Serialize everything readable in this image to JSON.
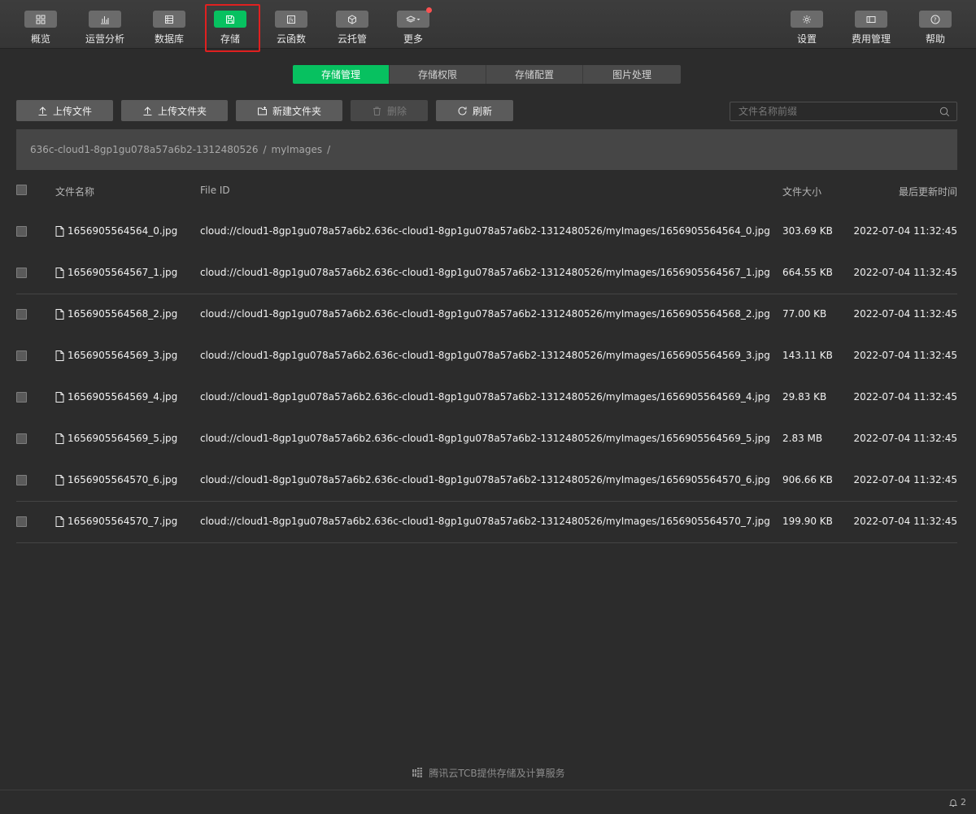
{
  "toolbar": {
    "left": [
      {
        "label": "概览",
        "icon": "grid-icon"
      },
      {
        "label": "运营分析",
        "icon": "bar-chart-icon"
      },
      {
        "label": "数据库",
        "icon": "database-icon"
      },
      {
        "label": "存储",
        "icon": "save-icon",
        "active": true
      },
      {
        "label": "云函数",
        "icon": "function-icon"
      },
      {
        "label": "云托管",
        "icon": "cube-icon"
      },
      {
        "label": "更多",
        "icon": "layers-icon",
        "badge": true
      }
    ],
    "right": [
      {
        "label": "设置",
        "icon": "gear-icon"
      },
      {
        "label": "费用管理",
        "icon": "wallet-icon"
      },
      {
        "label": "帮助",
        "icon": "help-icon"
      }
    ]
  },
  "tabs": [
    {
      "label": "存储管理",
      "active": true
    },
    {
      "label": "存储权限"
    },
    {
      "label": "存储配置"
    },
    {
      "label": "图片处理"
    }
  ],
  "actions": {
    "upload_file": "上传文件",
    "upload_folder": "上传文件夹",
    "new_folder": "新建文件夹",
    "delete": "删除",
    "refresh": "刷新"
  },
  "search": {
    "placeholder": "文件名称前缀"
  },
  "breadcrumb": {
    "bucket": "636c-cloud1-8gp1gu078a57a6b2-1312480526",
    "folder": "myImages",
    "separator": "/"
  },
  "table": {
    "headers": {
      "name": "文件名称",
      "file_id": "File ID",
      "size": "文件大小",
      "updated": "最后更新时间"
    },
    "rows": [
      {
        "name": "1656905564564_0.jpg",
        "file_id": "cloud://cloud1-8gp1gu078a57a6b2.636c-cloud1-8gp1gu078a57a6b2-1312480526/myImages/1656905564564_0.jpg",
        "size": "303.69 KB",
        "updated": "2022-07-04 11:32:45"
      },
      {
        "name": "1656905564567_1.jpg",
        "file_id": "cloud://cloud1-8gp1gu078a57a6b2.636c-cloud1-8gp1gu078a57a6b2-1312480526/myImages/1656905564567_1.jpg",
        "size": "664.55 KB",
        "updated": "2022-07-04 11:32:45"
      },
      {
        "name": "1656905564568_2.jpg",
        "file_id": "cloud://cloud1-8gp1gu078a57a6b2.636c-cloud1-8gp1gu078a57a6b2-1312480526/myImages/1656905564568_2.jpg",
        "size": "77.00 KB",
        "updated": "2022-07-04 11:32:45"
      },
      {
        "name": "1656905564569_3.jpg",
        "file_id": "cloud://cloud1-8gp1gu078a57a6b2.636c-cloud1-8gp1gu078a57a6b2-1312480526/myImages/1656905564569_3.jpg",
        "size": "143.11 KB",
        "updated": "2022-07-04 11:32:45"
      },
      {
        "name": "1656905564569_4.jpg",
        "file_id": "cloud://cloud1-8gp1gu078a57a6b2.636c-cloud1-8gp1gu078a57a6b2-1312480526/myImages/1656905564569_4.jpg",
        "size": "29.83 KB",
        "updated": "2022-07-04 11:32:45"
      },
      {
        "name": "1656905564569_5.jpg",
        "file_id": "cloud://cloud1-8gp1gu078a57a6b2.636c-cloud1-8gp1gu078a57a6b2-1312480526/myImages/1656905564569_5.jpg",
        "size": "2.83 MB",
        "updated": "2022-07-04 11:32:45"
      },
      {
        "name": "1656905564570_6.jpg",
        "file_id": "cloud://cloud1-8gp1gu078a57a6b2.636c-cloud1-8gp1gu078a57a6b2-1312480526/myImages/1656905564570_6.jpg",
        "size": "906.66 KB",
        "updated": "2022-07-04 11:32:45"
      },
      {
        "name": "1656905564570_7.jpg",
        "file_id": "cloud://cloud1-8gp1gu078a57a6b2.636c-cloud1-8gp1gu078a57a6b2-1312480526/myImages/1656905564570_7.jpg",
        "size": "199.90 KB",
        "updated": "2022-07-04 11:32:45"
      }
    ]
  },
  "footer": {
    "text": "腾讯云TCB提供存储及计算服务"
  },
  "notifications": {
    "count": "2"
  },
  "colors": {
    "accent": "#07c160",
    "background": "#2c2c2c",
    "highlight": "#e02020",
    "badge": "#fa5151"
  }
}
